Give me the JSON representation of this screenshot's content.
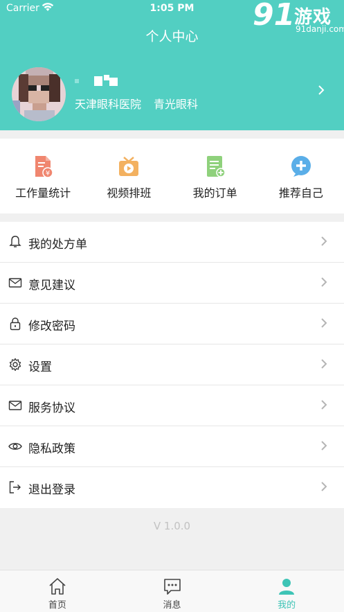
{
  "status_bar": {
    "carrier": "Carrier",
    "time": "1:05 PM"
  },
  "watermark": {
    "number": "91",
    "text": "游戏",
    "url": "91danji.com"
  },
  "header": {
    "title": "个人中心"
  },
  "profile": {
    "hospital": "天津眼科医院",
    "department": "青光眼科"
  },
  "quick_actions": [
    {
      "label": "工作量统计",
      "icon": "workload-stats-icon"
    },
    {
      "label": "视频排班",
      "icon": "video-schedule-icon"
    },
    {
      "label": "我的订单",
      "icon": "my-orders-icon"
    },
    {
      "label": "推荐自己",
      "icon": "recommend-self-icon"
    }
  ],
  "menu": [
    {
      "label": "我的处方单",
      "icon": "bell-icon"
    },
    {
      "label": "意见建议",
      "icon": "envelope-icon"
    },
    {
      "label": "修改密码",
      "icon": "lock-icon"
    },
    {
      "label": "设置",
      "icon": "gear-icon"
    },
    {
      "label": "服务协议",
      "icon": "envelope-icon"
    },
    {
      "label": "隐私政策",
      "icon": "eye-icon"
    },
    {
      "label": "退出登录",
      "icon": "logout-icon"
    }
  ],
  "version": "V 1.0.0",
  "tabbar": [
    {
      "label": "首页",
      "icon": "home-icon",
      "active": false
    },
    {
      "label": "消息",
      "icon": "message-icon",
      "active": false
    },
    {
      "label": "我的",
      "icon": "profile-icon",
      "active": true
    }
  ],
  "colors": {
    "brand": "#52cfc2",
    "active_tab": "#3ec4b6"
  }
}
